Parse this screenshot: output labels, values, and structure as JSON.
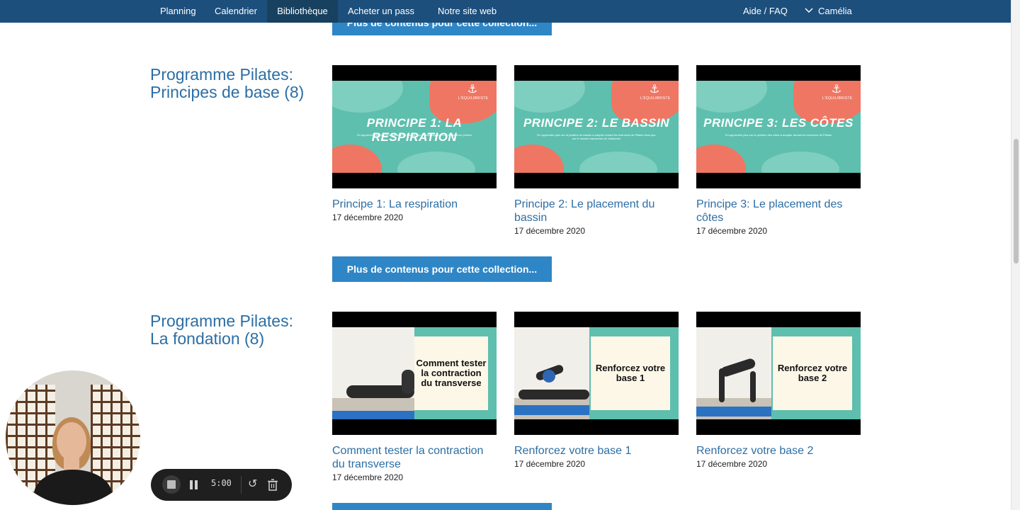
{
  "nav": {
    "items": [
      "Planning",
      "Calendrier",
      "Bibliothèque",
      "Acheter un pass",
      "Notre site web"
    ],
    "help": "Aide / FAQ",
    "user": "Camélia"
  },
  "more_button": "Plus de contenus pour cette collection...",
  "sections": [
    {
      "title": "Programme Pilates: Principes de base",
      "count": "(8)",
      "cards": [
        {
          "title": "Principe 1: La respiration",
          "date": "17 décembre 2020",
          "slide_head": "PRINCIPE 1: LA RESPIRATION",
          "slide_sub": "En apprendre plus sur la respiration en Pilates, sur le diaphragme et sur le plancher pelvien"
        },
        {
          "title": "Principe 2: Le placement du bassin",
          "date": "17 décembre 2020",
          "slide_head": "PRINCIPE 2: LE BASSIN",
          "slide_sub": "En apprendre plus sur la position du bassin à adopter durant les exercices de Pilates ainsi que sur le muscle transverse de l'abdomen"
        },
        {
          "title": "Principe 3: Le placement des côtes",
          "date": "17 décembre 2020",
          "slide_head": "PRINCIPE 3: LES CÔTES",
          "slide_sub": "En apprendre plus sur la position des côtes à adopter durant les exercices de Pilates"
        }
      ]
    },
    {
      "title": "Programme Pilates: La fondation",
      "count": "(8)",
      "cards": [
        {
          "title": "Comment tester la contraction du transverse",
          "date": "17 décembre 2020",
          "panel": "Comment tester la contraction du transverse"
        },
        {
          "title": "Renforcez votre base 1",
          "date": "17 décembre 2020",
          "panel": "Renforcez votre base 1"
        },
        {
          "title": "Renforcez votre base 2",
          "date": "17 décembre 2020",
          "panel": "Renforcez votre base 2"
        }
      ]
    }
  ],
  "brand": "L'ÉQUILIBRISTE",
  "recorder": {
    "time": "5:00"
  },
  "colors": {
    "nav": "#1c4f7c",
    "button": "#2e86c6",
    "link": "#2c6ea4",
    "teal": "#5ebfae",
    "coral": "#ef7663"
  }
}
